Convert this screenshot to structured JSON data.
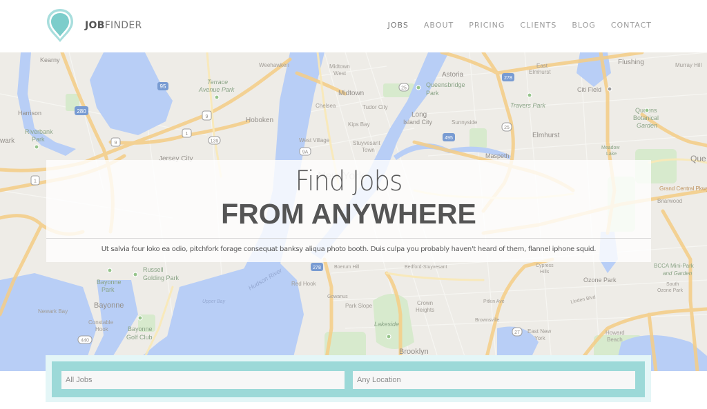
{
  "header": {
    "logo_bold": "JOB",
    "logo_light": "FINDER",
    "nav": [
      {
        "label": "JOBS",
        "active": true
      },
      {
        "label": "ABOUT",
        "active": false
      },
      {
        "label": "PRICING",
        "active": false
      },
      {
        "label": "CLIENTS",
        "active": false
      },
      {
        "label": "BLOG",
        "active": false
      },
      {
        "label": "CONTACT",
        "active": false
      }
    ]
  },
  "hero": {
    "title_line1": "Find Jobs",
    "title_line2": "FROM ANYWHERE",
    "subtitle": "Ut salvia four loko ea odio, pitchfork forage consequat banksy aliqua photo booth. Duis culpa you probably haven't heard of them, flannel iphone squid."
  },
  "search": {
    "jobs_placeholder": "All Jobs",
    "location_placeholder": "Any Location"
  },
  "map": {
    "labels": {
      "kearny": "Kearny",
      "harrison": "Harrison",
      "riverbank": "Riverbank",
      "riverbank2": "Park",
      "newark": "wark",
      "terrace": "Terrace",
      "terrace2": "Avenue Park",
      "hoboken": "Hoboken",
      "jersey_city": "Jersey City",
      "weehawken": "Weehawken",
      "midtown_west": "Midtown",
      "midtown_west2": "West",
      "midtown": "Midtown",
      "chelsea": "Chelsea",
      "tudor_city": "Tudor City",
      "kips_bay": "Kips Bay",
      "west_village": "West Village",
      "stuyvesant": "Stuyvesant",
      "stuyvesant2": "Town",
      "astoria": "Astoria",
      "queensbridge": "Queensbridge",
      "queensbridge2": "Park",
      "long_island": "Long",
      "long_island2": "Island City",
      "sunnyside": "Sunnyside",
      "maspeth": "Maspeth",
      "east_elmhurst": "East",
      "east_elmhurst2": "Elmhurst",
      "travers": "Travers Park",
      "elmhurst": "Elmhurst",
      "citi_field": "Citi Field",
      "flushing": "Flushing",
      "murray_hill": "Murray Hill",
      "queens_bot": "Queens",
      "queens_bot2": "Botanical",
      "queens_bot3": "Garden",
      "meadow": "Meadow",
      "meadow2": "Lake",
      "queens": "Que",
      "grand_central": "Grand Central Pkwy",
      "briarwood": "Briarwood",
      "bayonne_park": "Bayonne",
      "bayonne_park2": "Park",
      "russell": "Russell",
      "russell2": "Golding Park",
      "bayonne": "Bayonne",
      "newark_bay": "Newark Bay",
      "constable": "Constable",
      "constable2": "Hook",
      "bayonne_golf": "Bayonne",
      "bayonne_golf2": "Golf Club",
      "upper_bay": "Upper Bay",
      "hudson": "Hudson River",
      "red_hook": "Red Hook",
      "gowanus": "Gowanus",
      "boerum": "Boerum Hill",
      "bedford": "Bedford-Stuyvesant",
      "park_slope": "Park Slope",
      "crown": "Crown",
      "crown2": "Heights",
      "lakeside": "Lakeside",
      "brooklyn": "Brooklyn",
      "brownsville": "Brownsville",
      "east_ny": "East New",
      "east_ny2": "York",
      "cypress": "Cypress",
      "cypress2": "Hills",
      "ozone": "Ozone Park",
      "howard": "Howard",
      "howard2": "Beach",
      "bcca": "BCCA Mini-Park",
      "bcca2": "and Garden",
      "south_ozone": "South",
      "south_ozone2": "Ozone Park",
      "linden": "Linden Blvd",
      "pitkin": "Pitkin Ave",
      "new_york": "New York"
    },
    "shields": {
      "i280": "280",
      "i95": "95",
      "i278": "278",
      "i495": "495",
      "us9": "9",
      "us1": "1",
      "r139": "139",
      "r9a": "9A",
      "r25": "25",
      "r25b": "25",
      "r440": "440",
      "i278b": "278",
      "r27": "27",
      "us1b": "1"
    }
  }
}
